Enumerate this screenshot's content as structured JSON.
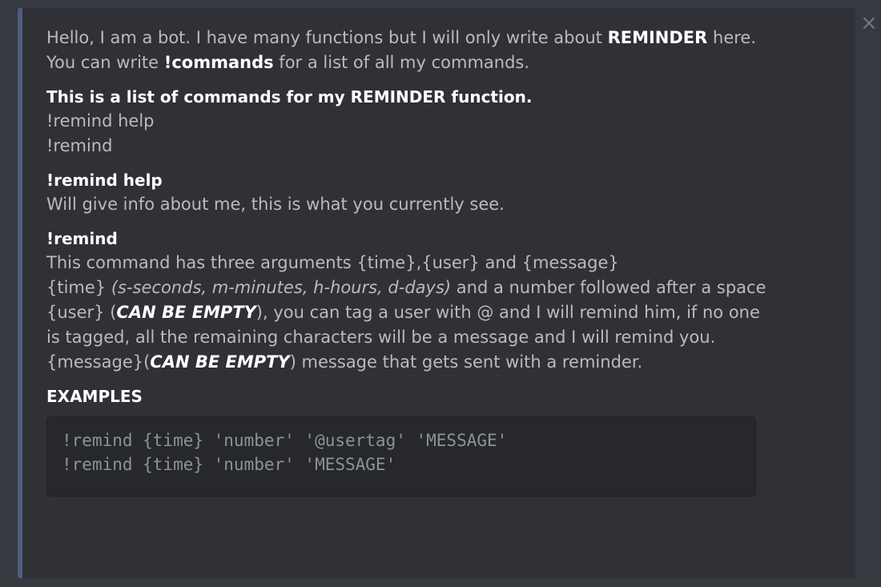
{
  "embed": {
    "close_glyph": "×",
    "description": {
      "line1_a": "Hello, I am a bot. I have many functions but I will only write about ",
      "line1_b": "REMINDER",
      "line1_c": " here.",
      "line2_a": "You can write ",
      "line2_b": "!commands",
      "line2_c": " for a list of all my commands."
    },
    "fields": [
      {
        "title": "This is a list of commands for my REMINDER function.",
        "lines": [
          "!remind help",
          "!remind"
        ]
      },
      {
        "title": "!remind help",
        "lines": [
          "Will give info about me, this is what you currently see."
        ]
      },
      {
        "title": "!remind",
        "line1": "This command has three arguments {time},{user} and {message}",
        "line2_a": "{time} ",
        "line2_b": "(s-seconds, m-minutes, h-hours, d-days)",
        "line2_c": " and a number followed after a space",
        "line3_a": "{user} (",
        "line3_b": "CAN BE EMPTY",
        "line3_c": "), you can tag a user with @ and I will remind him, if no one",
        "line4": "is tagged, all the remaining characters will be a message and I will remind you.",
        "line5_a": "{message}(",
        "line5_b": "CAN BE EMPTY",
        "line5_c": ") message that gets sent with a reminder."
      },
      {
        "title": "EXAMPLES",
        "code_lines": [
          "!remind {time} 'number' '@usertag' 'MESSAGE'",
          "!remind {time} 'number' 'MESSAGE'"
        ]
      }
    ]
  },
  "colors": {
    "background": "#36393f",
    "embed_background": "#2f3136",
    "embed_accent": "#4f5d7e",
    "text_muted": "#b9bbbe",
    "text_strong": "#ffffff",
    "code_background": "#26282c"
  },
  "icons": {
    "close": "close-icon"
  }
}
